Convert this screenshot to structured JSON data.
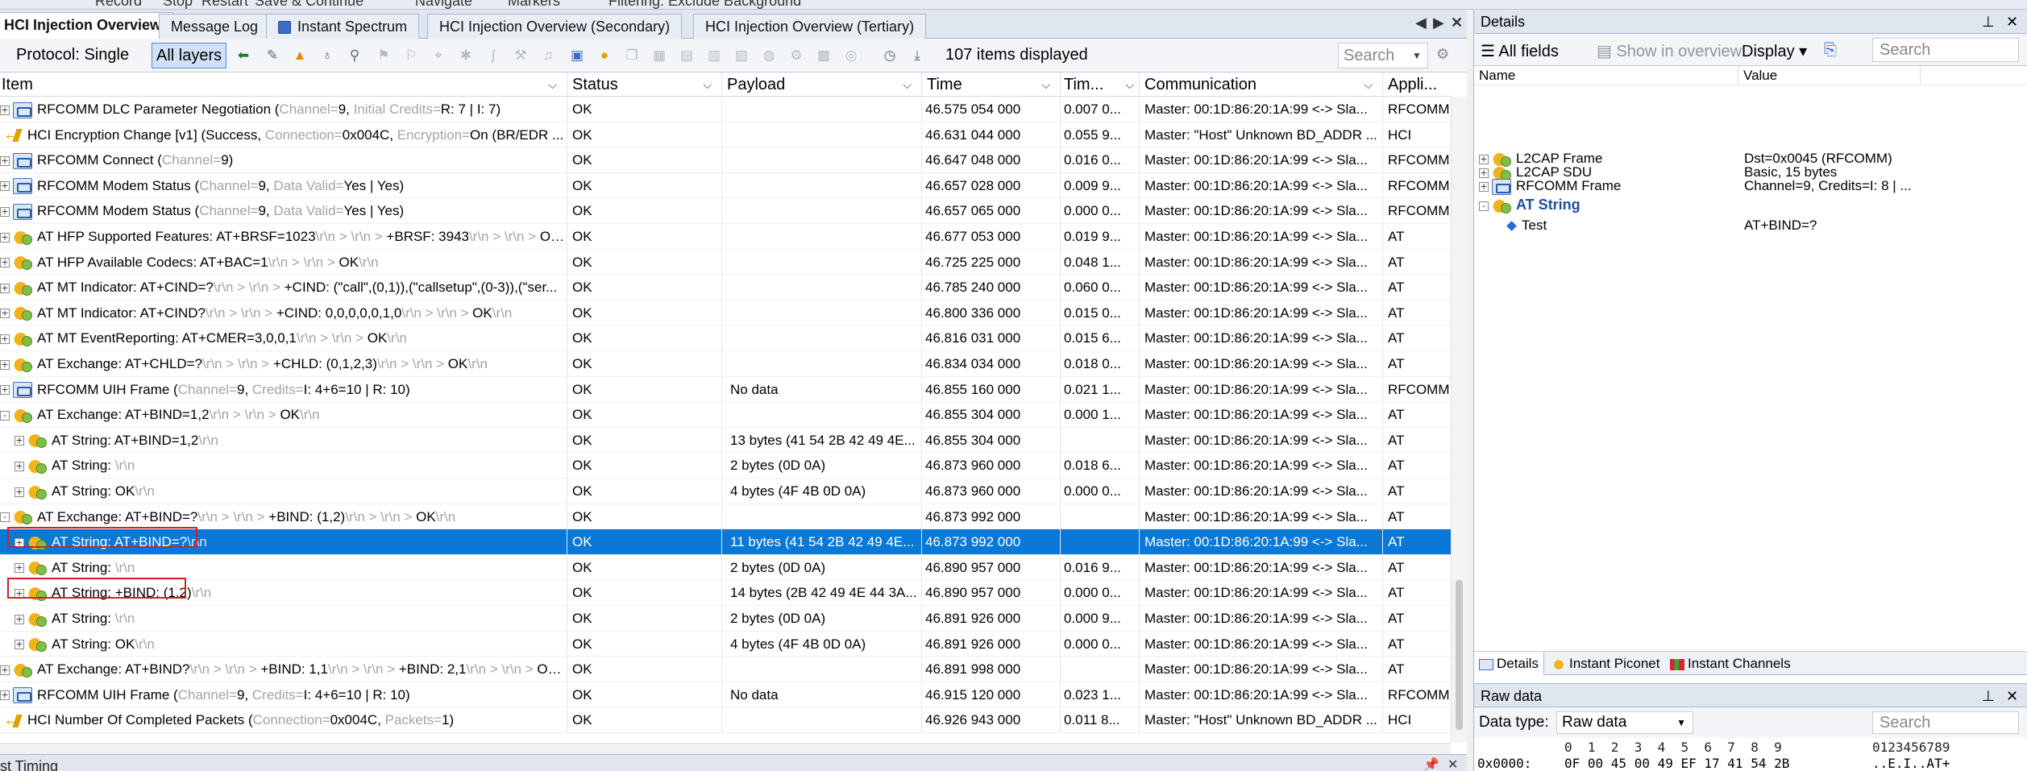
{
  "top_menu": [
    "Record",
    "Stop",
    "Restart",
    "Save & Continue",
    "Navigate",
    "Markers",
    "Filtering: Exclude Background"
  ],
  "tabs": [
    {
      "label": "HCI Injection Overview",
      "active": true
    },
    {
      "label": "Message Log",
      "active": false
    },
    {
      "label": "Instant Spectrum",
      "active": false
    },
    {
      "label": "HCI Injection Overview (Secondary)",
      "active": false
    },
    {
      "label": "HCI Injection Overview (Tertiary)",
      "active": false
    }
  ],
  "tab_controls": {
    "prev": "◀",
    "next": "▶",
    "close": "✕"
  },
  "toolbar": {
    "protocol": "Protocol: Single",
    "all_layers": "All layers",
    "items_displayed": "107 items displayed",
    "search_placeholder": "Search"
  },
  "columns": [
    "Item",
    "Status",
    "Payload",
    "Time",
    "Tim...",
    "Communication",
    "Appli..."
  ],
  "rows": [
    {
      "level": 0,
      "exp": "+",
      "icon": "frame",
      "main": "RFCOMM DLC Parameter Negotiation (",
      "parts": [
        [
          "sub",
          "Channel="
        ],
        [
          "",
          "9, "
        ],
        [
          "sub",
          "Initial Credits="
        ],
        [
          "",
          "R: 7 | I: 7)"
        ]
      ],
      "status": "OK",
      "payload": "",
      "time": "46.575 054 000",
      "delta": "0.007 0...",
      "comm": "Master: 00:1D:86:20:1A:99 <-> Sla...",
      "app": "RFCOMM"
    },
    {
      "level": 0,
      "exp": "",
      "icon": "hci",
      "main": "HCI Encryption Change [v1] (Success, ",
      "parts": [
        [
          "sub",
          "Connection="
        ],
        [
          "",
          "0x004C, "
        ],
        [
          "sub",
          "Encryption="
        ],
        [
          "",
          "On (BR/EDR ..."
        ]
      ],
      "status": "OK",
      "payload": "",
      "time": "46.631 044 000",
      "delta": "0.055 9...",
      "comm": "Master: \"Host\" Unknown BD_ADDR ...",
      "app": "HCI"
    },
    {
      "level": 0,
      "exp": "+",
      "icon": "frame",
      "main": "RFCOMM Connect (",
      "parts": [
        [
          "sub",
          "Channel="
        ],
        [
          "",
          "9)"
        ]
      ],
      "status": "OK",
      "payload": "",
      "time": "46.647 048 000",
      "delta": "0.016 0...",
      "comm": "Master: 00:1D:86:20:1A:99 <-> Sla...",
      "app": "RFCOMM"
    },
    {
      "level": 0,
      "exp": "+",
      "icon": "frame",
      "main": "RFCOMM Modem Status (",
      "parts": [
        [
          "sub",
          "Channel="
        ],
        [
          "",
          "9, "
        ],
        [
          "sub",
          "Data Valid="
        ],
        [
          "",
          "Yes | Yes)"
        ]
      ],
      "status": "OK",
      "payload": "",
      "time": "46.657 028 000",
      "delta": "0.009 9...",
      "comm": "Master: 00:1D:86:20:1A:99 <-> Sla...",
      "app": "RFCOMM"
    },
    {
      "level": 0,
      "exp": "+",
      "icon": "frame",
      "main": "RFCOMM Modem Status (",
      "parts": [
        [
          "sub",
          "Channel="
        ],
        [
          "",
          "9, "
        ],
        [
          "sub",
          "Data Valid="
        ],
        [
          "",
          "Yes | Yes)"
        ]
      ],
      "status": "OK",
      "payload": "",
      "time": "46.657 065 000",
      "delta": "0.000 0...",
      "comm": "Master: 00:1D:86:20:1A:99 <-> Sla...",
      "app": "RFCOMM"
    },
    {
      "level": 0,
      "exp": "+",
      "icon": "at",
      "main": "AT HFP Supported Features: AT+BRSF=1023",
      "parts": [
        [
          "sub",
          "\\r\\n > \\r\\n > "
        ],
        [
          "",
          "+BRSF: 3943"
        ],
        [
          "sub",
          "\\r\\n > \\r\\n > "
        ],
        [
          "",
          "OK"
        ],
        [
          "sub",
          "\\r\\n"
        ]
      ],
      "status": "OK",
      "payload": "",
      "time": "46.677 053 000",
      "delta": "0.019 9...",
      "comm": "Master: 00:1D:86:20:1A:99 <-> Sla...",
      "app": "AT"
    },
    {
      "level": 0,
      "exp": "+",
      "icon": "at",
      "main": "AT HFP Available Codecs: AT+BAC=1",
      "parts": [
        [
          "sub",
          "\\r\\n > \\r\\n > "
        ],
        [
          "",
          "OK"
        ],
        [
          "sub",
          "\\r\\n"
        ]
      ],
      "status": "OK",
      "payload": "",
      "time": "46.725 225 000",
      "delta": "0.048 1...",
      "comm": "Master: 00:1D:86:20:1A:99 <-> Sla...",
      "app": "AT"
    },
    {
      "level": 0,
      "exp": "+",
      "icon": "at",
      "main": "AT MT Indicator: AT+CIND=?",
      "parts": [
        [
          "sub",
          "\\r\\n > \\r\\n > "
        ],
        [
          "",
          "+CIND: (\"call\",(0,1)),(\"callsetup\",(0-3)),(\"ser..."
        ]
      ],
      "status": "OK",
      "payload": "",
      "time": "46.785 240 000",
      "delta": "0.060 0...",
      "comm": "Master: 00:1D:86:20:1A:99 <-> Sla...",
      "app": "AT"
    },
    {
      "level": 0,
      "exp": "+",
      "icon": "at",
      "main": "AT MT Indicator: AT+CIND?",
      "parts": [
        [
          "sub",
          "\\r\\n > \\r\\n > "
        ],
        [
          "",
          "+CIND: 0,0,0,0,0,1,0"
        ],
        [
          "sub",
          "\\r\\n > \\r\\n > "
        ],
        [
          "",
          "OK"
        ],
        [
          "sub",
          "\\r\\n"
        ]
      ],
      "status": "OK",
      "payload": "",
      "time": "46.800 336 000",
      "delta": "0.015 0...",
      "comm": "Master: 00:1D:86:20:1A:99 <-> Sla...",
      "app": "AT"
    },
    {
      "level": 0,
      "exp": "+",
      "icon": "at",
      "main": "AT MT EventReporting: AT+CMER=3,0,0,1",
      "parts": [
        [
          "sub",
          "\\r\\n > \\r\\n > "
        ],
        [
          "",
          "OK"
        ],
        [
          "sub",
          "\\r\\n"
        ]
      ],
      "status": "OK",
      "payload": "",
      "time": "46.816 031 000",
      "delta": "0.015 6...",
      "comm": "Master: 00:1D:86:20:1A:99 <-> Sla...",
      "app": "AT"
    },
    {
      "level": 0,
      "exp": "+",
      "icon": "at",
      "main": "AT Exchange: AT+CHLD=?",
      "parts": [
        [
          "sub",
          "\\r\\n > \\r\\n > "
        ],
        [
          "",
          "+CHLD: (0,1,2,3)"
        ],
        [
          "sub",
          "\\r\\n > \\r\\n > "
        ],
        [
          "",
          "OK"
        ],
        [
          "sub",
          "\\r\\n"
        ]
      ],
      "status": "OK",
      "payload": "",
      "time": "46.834 034 000",
      "delta": "0.018 0...",
      "comm": "Master: 00:1D:86:20:1A:99 <-> Sla...",
      "app": "AT"
    },
    {
      "level": 0,
      "exp": "+",
      "icon": "frame",
      "main": "RFCOMM UIH Frame (",
      "parts": [
        [
          "sub",
          "Channel="
        ],
        [
          "",
          "9, "
        ],
        [
          "sub",
          "Credits="
        ],
        [
          "",
          "I: 4+6=10 | R: 10)"
        ]
      ],
      "status": "OK",
      "payload": "No data",
      "time": "46.855 160 000",
      "delta": "0.021 1...",
      "comm": "Master: 00:1D:86:20:1A:99 <-> Sla...",
      "app": "RFCOMM"
    },
    {
      "level": 0,
      "exp": "-",
      "icon": "at",
      "main": "AT Exchange: AT+BIND=1,2",
      "parts": [
        [
          "sub",
          "\\r\\n > \\r\\n > "
        ],
        [
          "",
          "OK"
        ],
        [
          "sub",
          "\\r\\n"
        ]
      ],
      "status": "OK",
      "payload": "",
      "time": "46.855 304 000",
      "delta": "0.000 1...",
      "comm": "Master: 00:1D:86:20:1A:99 <-> Sla...",
      "app": "AT"
    },
    {
      "level": 1,
      "exp": "+",
      "icon": "at",
      "main": "AT String: AT+BIND=1,2",
      "parts": [
        [
          "sub",
          "\\r\\n"
        ]
      ],
      "status": "OK",
      "payload": "13 bytes (41 54 2B 42 49 4E...",
      "time": "46.855 304 000",
      "delta": "",
      "comm": "Master: 00:1D:86:20:1A:99 <-> Sla...",
      "app": "AT"
    },
    {
      "level": 1,
      "exp": "+",
      "icon": "at",
      "main": "AT String: ",
      "parts": [
        [
          "sub",
          "\\r\\n"
        ]
      ],
      "status": "OK",
      "payload": "2 bytes (0D 0A)",
      "time": "46.873 960 000",
      "delta": "0.018 6...",
      "comm": "Master: 00:1D:86:20:1A:99 <-> Sla...",
      "app": "AT"
    },
    {
      "level": 1,
      "exp": "+",
      "icon": "at",
      "main": "AT String: OK",
      "parts": [
        [
          "sub",
          "\\r\\n"
        ]
      ],
      "status": "OK",
      "payload": "4 bytes (4F 4B 0D 0A)",
      "time": "46.873 960 000",
      "delta": "0.000 0...",
      "comm": "Master: 00:1D:86:20:1A:99 <-> Sla...",
      "app": "AT"
    },
    {
      "level": 0,
      "exp": "-",
      "icon": "at",
      "main": "AT Exchange: AT+BIND=?",
      "parts": [
        [
          "sub",
          "\\r\\n > \\r\\n > "
        ],
        [
          "",
          "+BIND: (1,2)"
        ],
        [
          "sub",
          "\\r\\n > \\r\\n > "
        ],
        [
          "",
          "OK"
        ],
        [
          "sub",
          "\\r\\n"
        ]
      ],
      "status": "OK",
      "payload": "",
      "time": "46.873 992 000",
      "delta": "",
      "comm": "Master: 00:1D:86:20:1A:99 <-> Sla...",
      "app": "AT"
    },
    {
      "level": 1,
      "exp": "+",
      "icon": "at",
      "main": "AT String: AT+BIND=?",
      "parts": [
        [
          "sub",
          "\\r\\n"
        ]
      ],
      "status": "OK",
      "payload": "11 bytes (41 54 2B 42 49 4E...",
      "time": "46.873 992 000",
      "delta": "",
      "comm": "Master: 00:1D:86:20:1A:99 <-> Sla...",
      "app": "AT",
      "selected": true,
      "highlight": true
    },
    {
      "level": 1,
      "exp": "+",
      "icon": "at",
      "main": "AT String: ",
      "parts": [
        [
          "sub",
          "\\r\\n"
        ]
      ],
      "status": "OK",
      "payload": "2 bytes (0D 0A)",
      "time": "46.890 957 000",
      "delta": "0.016 9...",
      "comm": "Master: 00:1D:86:20:1A:99 <-> Sla...",
      "app": "AT"
    },
    {
      "level": 1,
      "exp": "+",
      "icon": "at",
      "main": "AT String: +BIND: (1,2)",
      "parts": [
        [
          "sub",
          "\\r\\n"
        ]
      ],
      "status": "OK",
      "payload": "14 bytes (2B 42 49 4E 44 3A...",
      "time": "46.890 957 000",
      "delta": "0.000 0...",
      "comm": "Master: 00:1D:86:20:1A:99 <-> Sla...",
      "app": "AT",
      "highlight": true
    },
    {
      "level": 1,
      "exp": "+",
      "icon": "at",
      "main": "AT String: ",
      "parts": [
        [
          "sub",
          "\\r\\n"
        ]
      ],
      "status": "OK",
      "payload": "2 bytes (0D 0A)",
      "time": "46.891 926 000",
      "delta": "0.000 9...",
      "comm": "Master: 00:1D:86:20:1A:99 <-> Sla...",
      "app": "AT"
    },
    {
      "level": 1,
      "exp": "+",
      "icon": "at",
      "main": "AT String: OK",
      "parts": [
        [
          "sub",
          "\\r\\n"
        ]
      ],
      "status": "OK",
      "payload": "4 bytes (4F 4B 0D 0A)",
      "time": "46.891 926 000",
      "delta": "0.000 0...",
      "comm": "Master: 00:1D:86:20:1A:99 <-> Sla...",
      "app": "AT"
    },
    {
      "level": 0,
      "exp": "+",
      "icon": "at",
      "main": "AT Exchange: AT+BIND?",
      "parts": [
        [
          "sub",
          "\\r\\n > \\r\\n > "
        ],
        [
          "",
          "+BIND: 1,1"
        ],
        [
          "sub",
          "\\r\\n > \\r\\n > "
        ],
        [
          "",
          "+BIND: 2,1"
        ],
        [
          "sub",
          "\\r\\n > \\r\\n > "
        ],
        [
          "",
          "OK"
        ],
        [
          "sub",
          "\\r\\n"
        ]
      ],
      "status": "OK",
      "payload": "",
      "time": "46.891 998 000",
      "delta": "",
      "comm": "Master: 00:1D:86:20:1A:99 <-> Sla...",
      "app": "AT"
    },
    {
      "level": 0,
      "exp": "+",
      "icon": "frame",
      "main": "RFCOMM UIH Frame (",
      "parts": [
        [
          "sub",
          "Channel="
        ],
        [
          "",
          "9, "
        ],
        [
          "sub",
          "Credits="
        ],
        [
          "",
          "I: 4+6=10 | R: 10)"
        ]
      ],
      "status": "OK",
      "payload": "No data",
      "time": "46.915 120 000",
      "delta": "0.023 1...",
      "comm": "Master: 00:1D:86:20:1A:99 <-> Sla...",
      "app": "RFCOMM"
    },
    {
      "level": 0,
      "exp": "",
      "icon": "hci",
      "main": "HCI Number Of Completed Packets (",
      "parts": [
        [
          "sub",
          "Connection="
        ],
        [
          "",
          "0x004C, "
        ],
        [
          "sub",
          "Packets="
        ],
        [
          "",
          "1)"
        ]
      ],
      "status": "OK",
      "payload": "",
      "time": "46.926 943 000",
      "delta": "0.011 8...",
      "comm": "Master: \"Host\" Unknown BD_ADDR ...",
      "app": "HCI"
    }
  ],
  "bottom_bar": {
    "title": "st Timing",
    "pin": "📌",
    "close": "✕"
  },
  "details": {
    "title": "Details",
    "pin": "📌",
    "close": "✕",
    "all_fields": "All fields",
    "show_in_overview": "Show in overview",
    "display": "Display",
    "search_placeholder": "Search",
    "col_name": "Name",
    "col_value": "Value",
    "fields": [
      {
        "exp": "+",
        "icon": "l2cap",
        "name": "L2CAP Frame",
        "value": "Dst=0x0045 (RFCOMM)"
      },
      {
        "exp": "+",
        "icon": "l2cap",
        "name": "L2CAP SDU",
        "value": "Basic, 15 bytes"
      },
      {
        "exp": "+",
        "icon": "frame",
        "name": "RFCOMM Frame",
        "value": "Channel=9, Credits=I: 8 | ..."
      },
      {
        "exp": "-",
        "icon": "at",
        "name": "AT String",
        "value": "",
        "bold": true
      },
      {
        "exp": "",
        "icon": "diamond",
        "name": "Test",
        "value": "AT+BIND=?",
        "indent": true
      }
    ],
    "bottom_tabs": [
      "Details",
      "Instant Piconet",
      "Instant Channels"
    ]
  },
  "raw": {
    "title": "Raw data",
    "pin": "📌",
    "close": "✕",
    "data_type_label": "Data type:",
    "data_type_value": "Raw data",
    "search_placeholder": "Search",
    "hex_header": "0  1  2  3  4  5  6  7  8  9",
    "ascii_header": "0123456789",
    "offset": "0x0000:",
    "hex_row": "0F 00 45 00 49 EF 17 41 54 2B",
    "ascii_row": "..E.I..AT+"
  }
}
